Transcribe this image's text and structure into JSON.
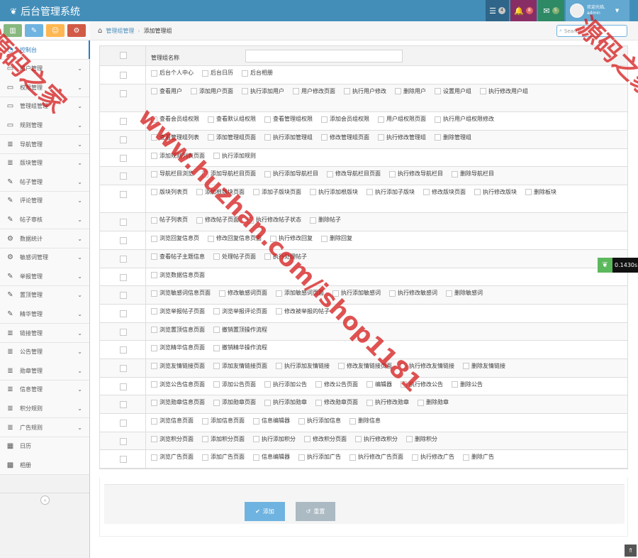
{
  "app": {
    "title": "后台管理系统",
    "user_greeting": "欢迎光临,",
    "user_name": "admin"
  },
  "navbar": {
    "tasks_count": "4",
    "notifications_count": "8",
    "messages_count": "5"
  },
  "sidebar": {
    "items": [
      {
        "label": "控制台",
        "icon": "dashboard-icon",
        "active": true
      },
      {
        "label": "用户管理",
        "icon": "desktop-icon"
      },
      {
        "label": "权限管理",
        "icon": "desktop-icon"
      },
      {
        "label": "管理组管理",
        "icon": "desktop-icon"
      },
      {
        "label": "规则管理",
        "icon": "desktop-icon"
      },
      {
        "label": "导航管理",
        "icon": "list-icon"
      },
      {
        "label": "版块管理",
        "icon": "list-icon"
      },
      {
        "label": "帖子管理",
        "icon": "edit-icon"
      },
      {
        "label": "评论管理",
        "icon": "edit-icon"
      },
      {
        "label": "帖子审核",
        "icon": "edit-icon"
      },
      {
        "label": "数据统计",
        "icon": "gear-icon"
      },
      {
        "label": "敏感词管理",
        "icon": "gear-icon"
      },
      {
        "label": "举报管理",
        "icon": "edit-icon"
      },
      {
        "label": "置顶管理",
        "icon": "edit-icon"
      },
      {
        "label": "精华管理",
        "icon": "edit-icon"
      },
      {
        "label": "链接管理",
        "icon": "list-icon"
      },
      {
        "label": "公告管理",
        "icon": "list-icon"
      },
      {
        "label": "勋章管理",
        "icon": "list-icon"
      },
      {
        "label": "信息管理",
        "icon": "list-icon"
      },
      {
        "label": "积分规则",
        "icon": "list-icon"
      },
      {
        "label": "广告规则",
        "icon": "list-icon"
      },
      {
        "label": "日历",
        "icon": "calendar-icon"
      },
      {
        "label": "相册",
        "icon": "picture-icon"
      }
    ]
  },
  "breadcrumb": {
    "parent": "管理组管理",
    "current": "添加管理组"
  },
  "search": {
    "placeholder": "Search ..."
  },
  "form": {
    "name_label": "管理组名称",
    "name_value": "",
    "rows": [
      [
        "后台个人中心",
        "后台日历",
        "后台相册"
      ],
      [
        "查看用户",
        "添加用户页面",
        "执行添加用户",
        "用户修改页面",
        "执行用户修改",
        "删除用户",
        "设置用户组",
        "执行修改用户组"
      ],
      [
        "查看会员组权限",
        "查看默认组权限",
        "查看管理组权限",
        "添加会员组权限",
        "用户组权限页面",
        "执行用户组权限修改"
      ],
      [
        "查看管理组列表",
        "添加管理组页面",
        "执行添加管理组",
        "修改管理组页面",
        "执行修改管理组",
        "删除管理组"
      ],
      [
        "添加规则列表页面",
        "执行添加规则"
      ],
      [
        "导航栏目浏览",
        "添加导航栏目页面",
        "执行添加导航栏目",
        "修改导航栏目页面",
        "执行修改导航栏目",
        "删除导航栏目"
      ],
      [
        "版块列表页",
        "添加根版块页面",
        "添加子版块页面",
        "执行添加根版块",
        "执行添加子版块",
        "修改版块页面",
        "执行修改版块",
        "删除板块"
      ],
      [
        "帖子列表页",
        "修改帖子页面",
        "执行修改帖子状态",
        "删除帖子"
      ],
      [
        "浏览回复信息页",
        "修改回复信息页面",
        "执行修改回复",
        "删除回复"
      ],
      [
        "查看帖子主题信息",
        "处理帖子页面",
        "执行处理帖子"
      ],
      [
        "浏览数据信息页面"
      ],
      [
        "浏览敏感词信息页面",
        "修改敏感词页面",
        "添加敏感词页面",
        "执行添加敏感词",
        "执行修改敏感词",
        "删除敏感词"
      ],
      [
        "浏览举报帖子页面",
        "浏览举报评论页面",
        "修改被举报的帖子"
      ],
      [
        "浏览置顶信息页面",
        "撤销置顶操作流程"
      ],
      [
        "浏览精华信息页面",
        "撤销精华操作流程"
      ],
      [
        "浏览友情链接页面",
        "添加友情链接页面",
        "执行添加友情链接",
        "修改友情链接页面",
        "执行修改友情链接",
        "删除友情链接"
      ],
      [
        "浏览公告信息页面",
        "添加公告页面",
        "执行添加公告",
        "修改公告页面",
        "编辑器",
        "执行修改公告",
        "删除公告"
      ],
      [
        "浏览勋章信息页面",
        "添加勋章页面",
        "执行添加勋章",
        "修改勋章页面",
        "执行修改勋章",
        "删除勋章"
      ],
      [
        "浏览信息页面",
        "添加信息页面",
        "信息编辑器",
        "执行添加信息",
        "删除信息"
      ],
      [
        "浏览积分页面",
        "添加积分页面",
        "执行添加积分",
        "修改积分页面",
        "执行修改积分",
        "删除积分"
      ],
      [
        "浏览广告页面",
        "添加广告页面",
        "信息编辑器",
        "执行添加广告",
        "执行修改广告页面",
        "执行修改广告",
        "删除广告"
      ]
    ],
    "submit_label": "添加",
    "reset_label": "重置"
  },
  "debug": {
    "timer": "0.1430s"
  },
  "watermark": {
    "line1": "源码之家",
    "line2": "www.huzhan.com/ishop1181",
    "line3": "源码之家"
  },
  "colors": {
    "navbar": "#438eb9",
    "accent": "#2b7dbc",
    "submit": "#6fb3e0",
    "reset": "#abbac3",
    "watermark": "#d51a1a"
  }
}
